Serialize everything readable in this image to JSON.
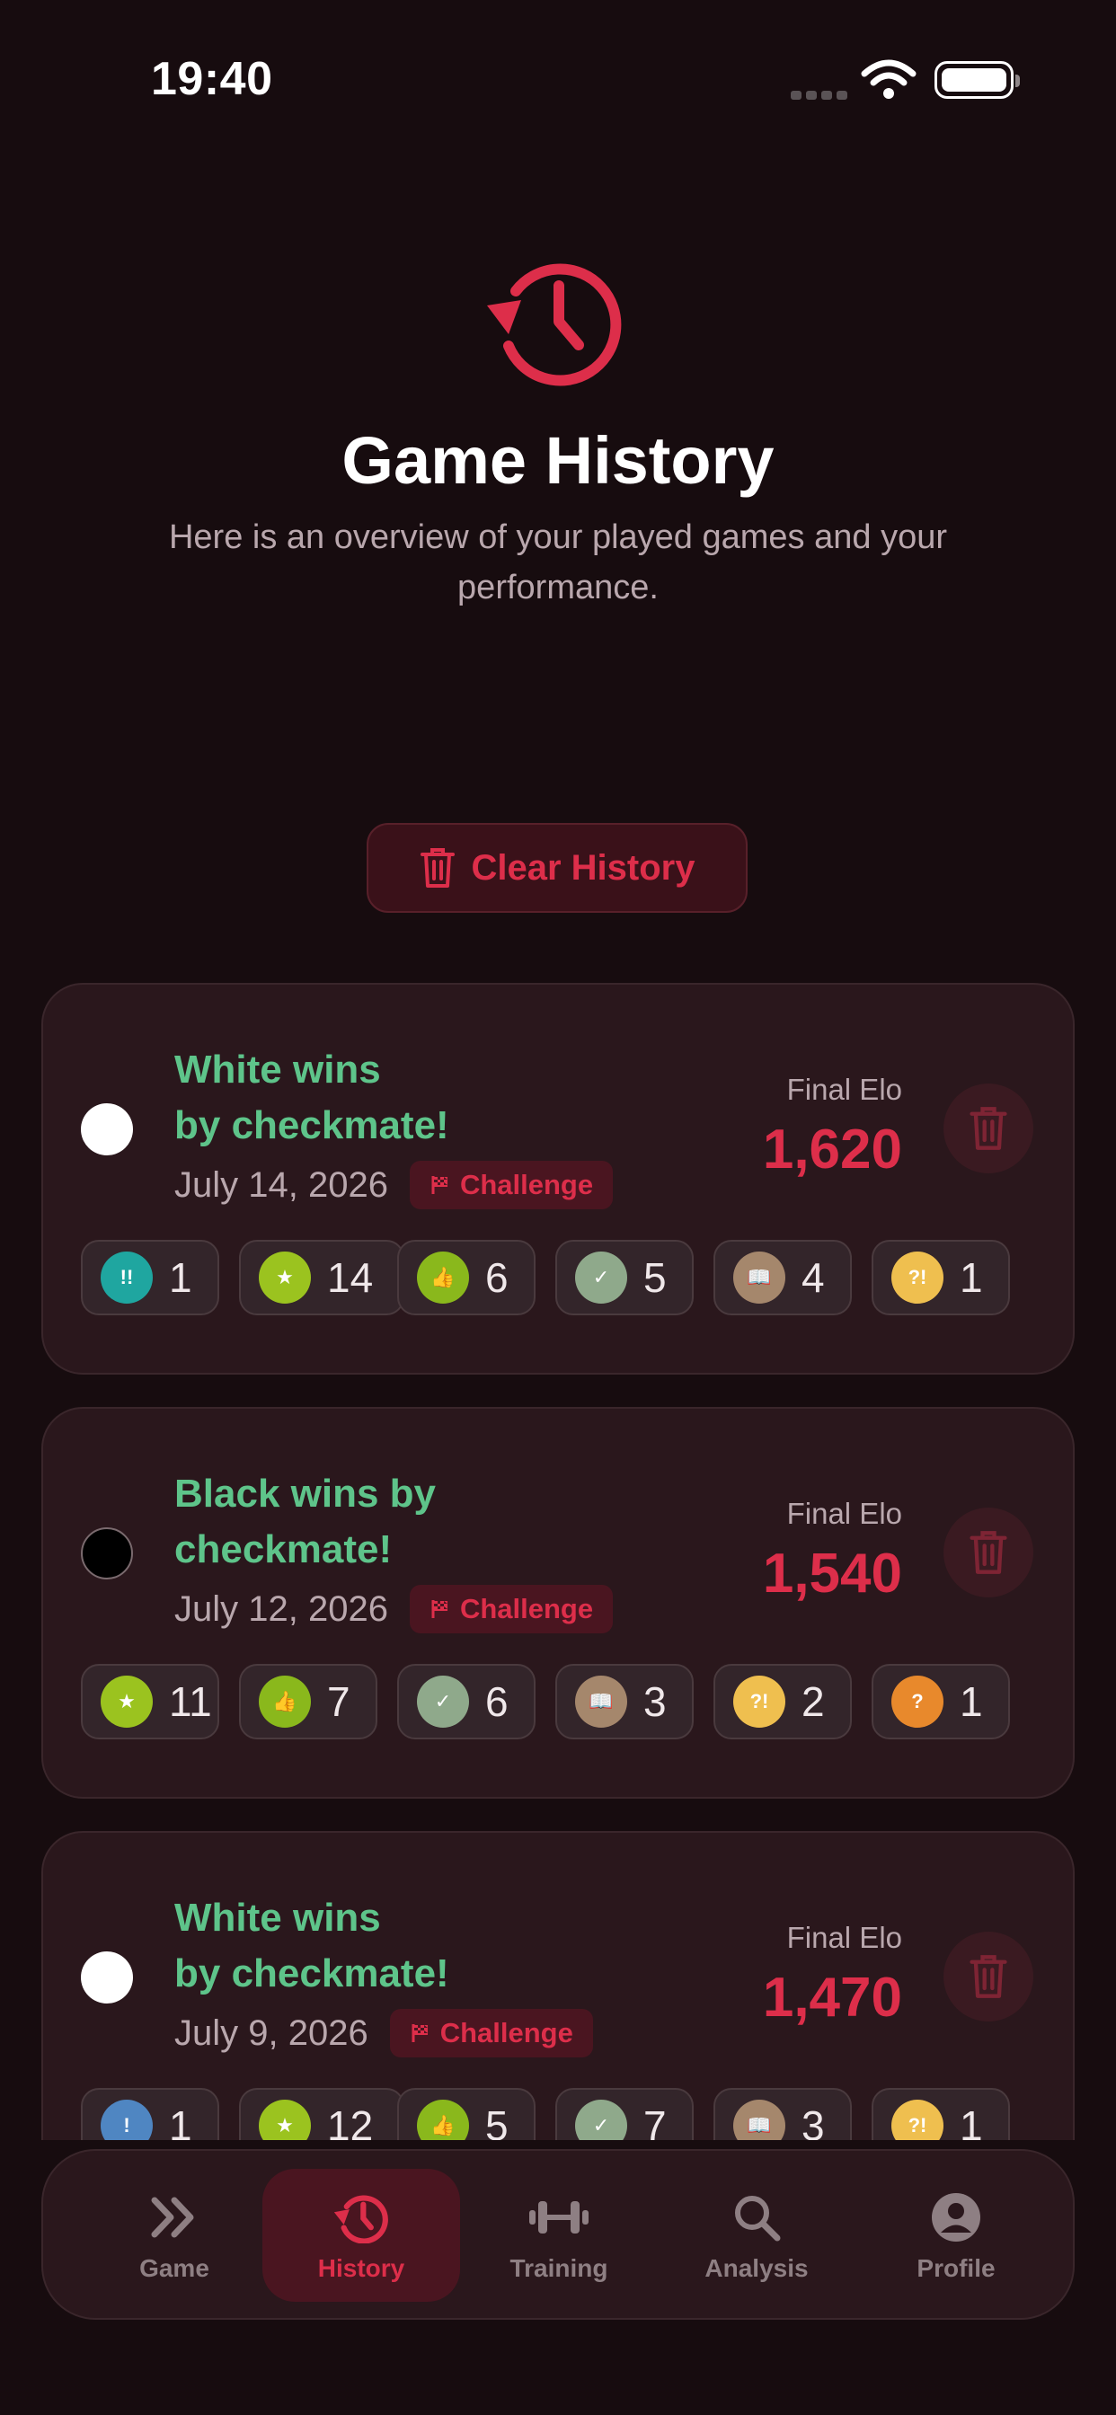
{
  "status_bar": {
    "time": "19:40"
  },
  "header": {
    "title": "Game History",
    "subtitle": "Here is an overview of your played games and your performance."
  },
  "clear_button": {
    "label": "Clear History"
  },
  "colors": {
    "accent": "#dd2e4a",
    "win_text": "#5ec48a",
    "background": "#170c0f",
    "card": "#2a171c"
  },
  "games": [
    {
      "result_line1": "White wins",
      "result_line2": "by checkmate!",
      "piece": "white",
      "date": "July 14, 2026",
      "mode": "Challenge",
      "elo_label": "Final Elo",
      "elo": "1,620",
      "stats": [
        {
          "icon": "brilliant-icon",
          "symbol": "!!",
          "color": "#1fa6a0",
          "count": "1"
        },
        {
          "icon": "star-icon",
          "symbol": "★",
          "color": "#9bc31f",
          "count": "14"
        },
        {
          "icon": "thumbs-up-icon",
          "symbol": "👍",
          "color": "#8ab81c",
          "count": "6"
        },
        {
          "icon": "check-icon",
          "symbol": "✓",
          "color": "#8fa98b",
          "count": "5"
        },
        {
          "icon": "book-icon",
          "symbol": "📖",
          "color": "#a5876c",
          "count": "4"
        },
        {
          "icon": "dubious-icon",
          "symbol": "?!",
          "color": "#efbf4f",
          "count": "1"
        }
      ]
    },
    {
      "result_line1": "Black wins by",
      "result_line2": "checkmate!",
      "piece": "black",
      "date": "July 12, 2026",
      "mode": "Challenge",
      "elo_label": "Final Elo",
      "elo": "1,540",
      "stats": [
        {
          "icon": "star-icon",
          "symbol": "★",
          "color": "#9bc31f",
          "count": "11"
        },
        {
          "icon": "thumbs-up-icon",
          "symbol": "👍",
          "color": "#8ab81c",
          "count": "7"
        },
        {
          "icon": "check-icon",
          "symbol": "✓",
          "color": "#8fa98b",
          "count": "6"
        },
        {
          "icon": "book-icon",
          "symbol": "📖",
          "color": "#a5876c",
          "count": "3"
        },
        {
          "icon": "dubious-icon",
          "symbol": "?!",
          "color": "#efbf4f",
          "count": "2"
        },
        {
          "icon": "mistake-icon",
          "symbol": "?",
          "color": "#e8892c",
          "count": "1"
        }
      ]
    },
    {
      "result_line1": "White wins",
      "result_line2": "by checkmate!",
      "piece": "white",
      "date": "July 9, 2026",
      "mode": "Challenge",
      "elo_label": "Final Elo",
      "elo": "1,470",
      "stats": [
        {
          "icon": "interesting-icon",
          "symbol": "!",
          "color": "#4f86c2",
          "count": "1"
        },
        {
          "icon": "star-icon",
          "symbol": "★",
          "color": "#9bc31f",
          "count": "12"
        },
        {
          "icon": "thumbs-up-icon",
          "symbol": "👍",
          "color": "#8ab81c",
          "count": "5"
        },
        {
          "icon": "check-icon",
          "symbol": "✓",
          "color": "#8fa98b",
          "count": "7"
        },
        {
          "icon": "book-icon",
          "symbol": "📖",
          "color": "#a5876c",
          "count": "3"
        },
        {
          "icon": "dubious-icon",
          "symbol": "?!",
          "color": "#efbf4f",
          "count": "1"
        }
      ]
    }
  ],
  "tabs": [
    {
      "label": "Game",
      "icon": "chevrons-icon",
      "active": false
    },
    {
      "label": "History",
      "icon": "history-icon",
      "active": true
    },
    {
      "label": "Training",
      "icon": "dumbbell-icon",
      "active": false
    },
    {
      "label": "Analysis",
      "icon": "search-icon",
      "active": false
    },
    {
      "label": "Profile",
      "icon": "profile-icon",
      "active": false
    }
  ]
}
